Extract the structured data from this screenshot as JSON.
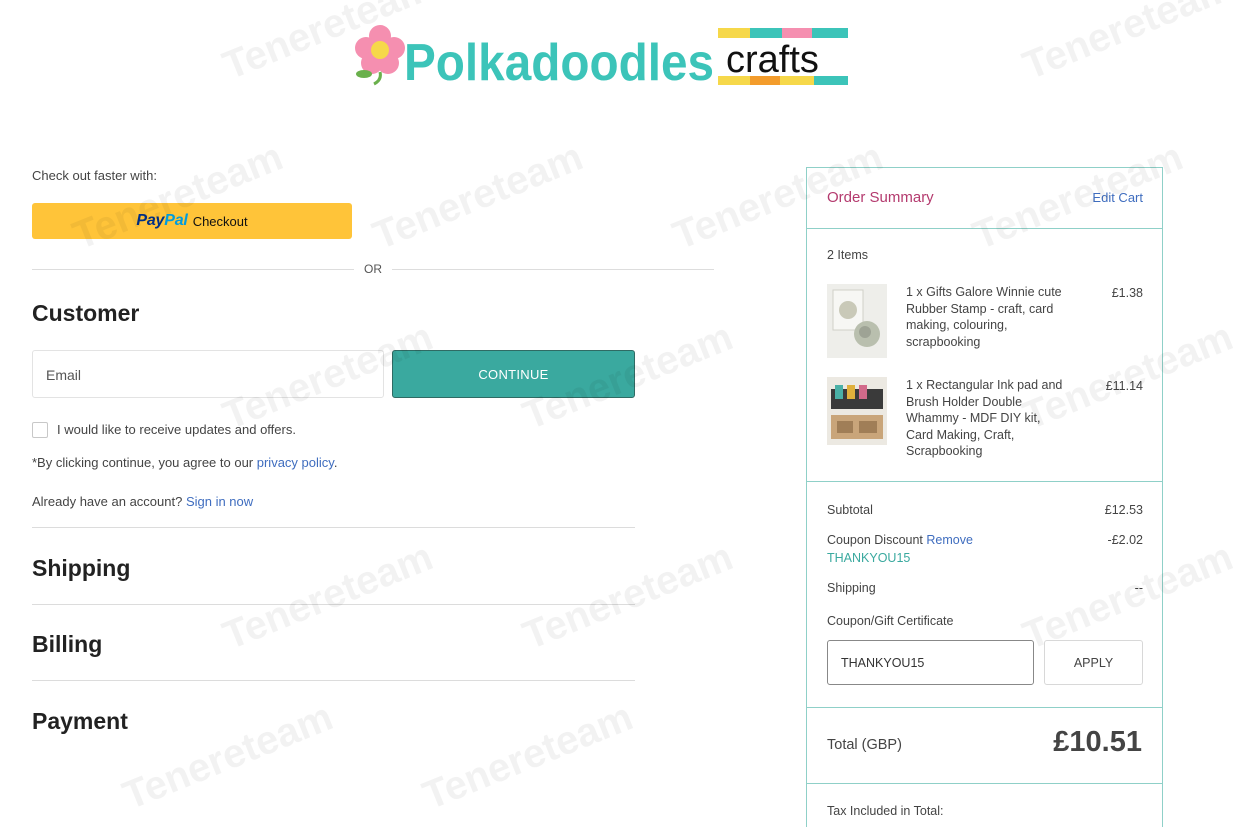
{
  "brand": {
    "logo_word": "Polkadoodles",
    "logo_suffix": "crafts"
  },
  "express_checkout": {
    "intro": "Check out faster with:",
    "paypal_pay": "Pay",
    "paypal_pal": "Pal",
    "paypal_label": "Checkout",
    "or_label": "OR"
  },
  "customer": {
    "title": "Customer",
    "email_label": "Email",
    "continue_label": "CONTINUE",
    "updates_label": "I would like to receive updates and offers.",
    "terms_prefix": "*By clicking continue, you agree to our ",
    "privacy_link": "privacy policy",
    "terms_suffix": ".",
    "account_prefix": "Already have an account? ",
    "sign_in_link": "Sign in now"
  },
  "sections": {
    "shipping": "Shipping",
    "billing": "Billing",
    "payment": "Payment"
  },
  "summary": {
    "title": "Order Summary",
    "edit_cart": "Edit Cart",
    "items_count": "2 Items",
    "items": [
      {
        "description": "1 x Gifts Galore Winnie cute Rubber Stamp - craft, card making, colouring, scrapbooking",
        "price": "£1.38"
      },
      {
        "description": "1 x Rectangular Ink pad and Brush Holder Double Whammy - MDF DIY kit, Card Making, Craft, Scrapbooking",
        "price": "£11.14"
      }
    ],
    "subtotal_label": "Subtotal",
    "subtotal_value": "£12.53",
    "coupon_discount_label": "Coupon Discount",
    "coupon_remove": "Remove",
    "coupon_discount_value": "-£2.02",
    "coupon_code": "THANKYOU15",
    "shipping_label": "Shipping",
    "shipping_value": "--",
    "gift_label": "Coupon/Gift Certificate",
    "coupon_input_value": "THANKYOU15",
    "apply_label": "APPLY",
    "total_label": "Total (GBP)",
    "total_value": "£10.51",
    "tax_label": "Tax Included in Total:"
  },
  "watermark": "Tenereteam",
  "colors": {
    "paypal_yellow": "#ffc439",
    "continue_teal": "#3aa99f",
    "summary_border": "#8fd0c8",
    "summary_title": "#b43a6e",
    "link_blue": "#3f6dbf"
  }
}
